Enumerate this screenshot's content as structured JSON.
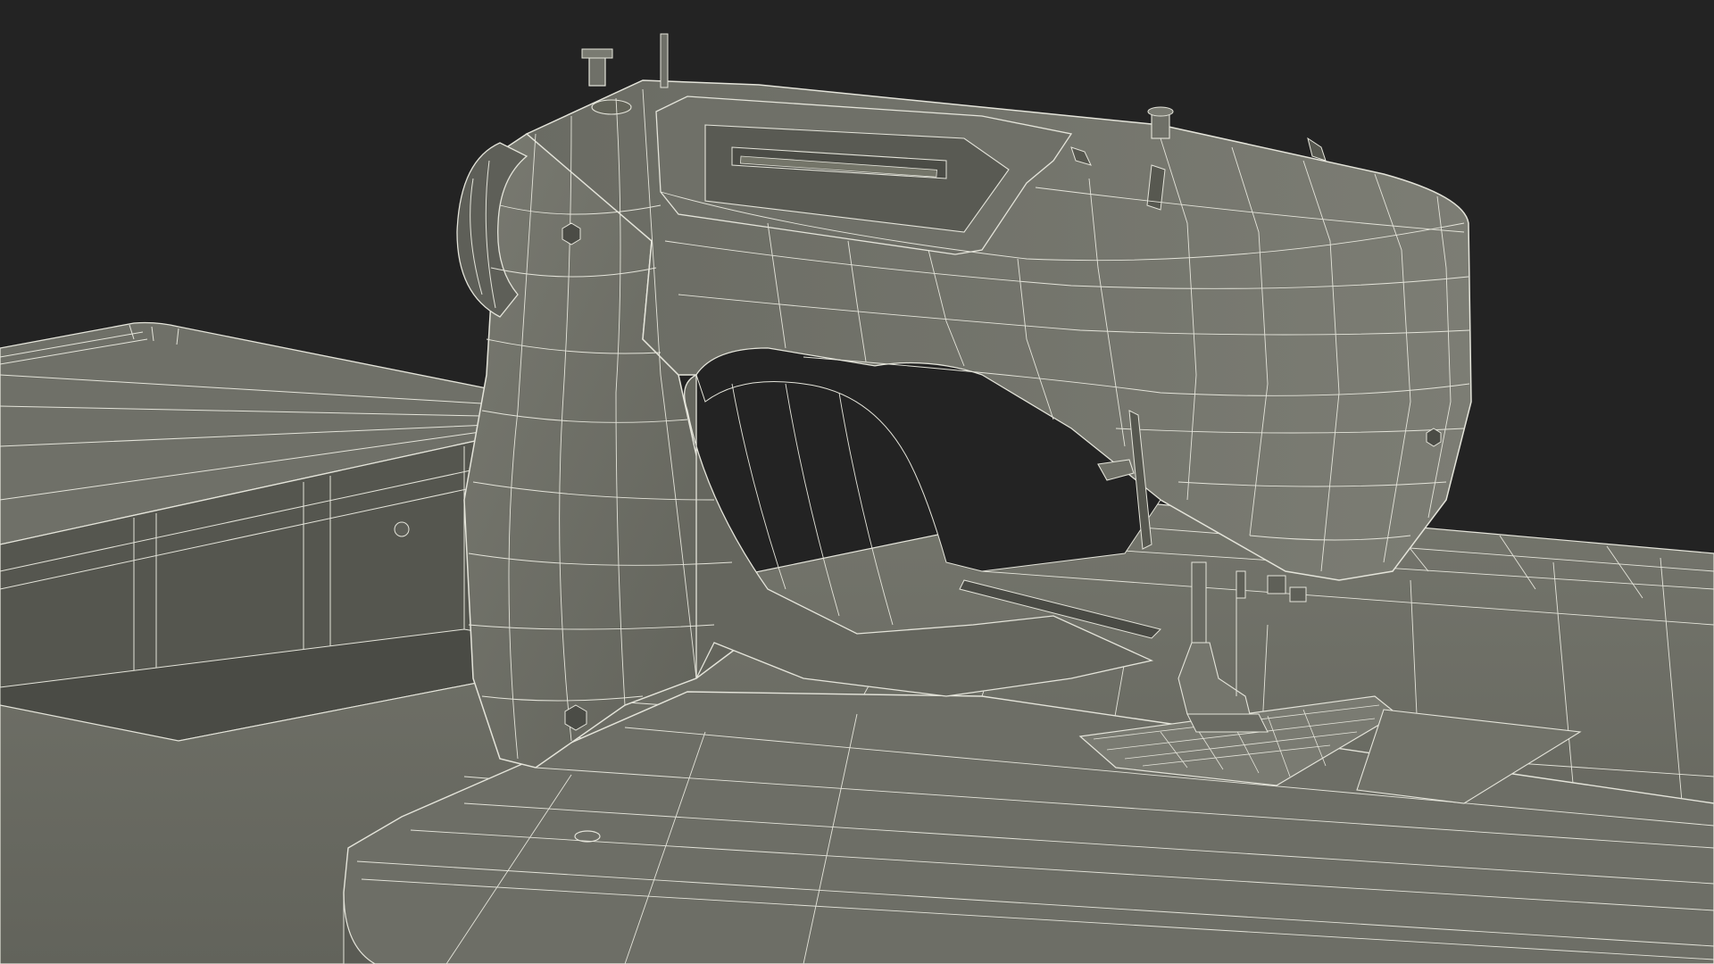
{
  "scene": {
    "subject": "sewing-machine-wireframe-render",
    "colors": {
      "background": "#232323",
      "surface": "#6c6d64",
      "surface_dark": "#4d4e47",
      "surface_light": "#7e7f76",
      "wire": "#e4e4da",
      "shadow": "#3a3b36"
    }
  }
}
